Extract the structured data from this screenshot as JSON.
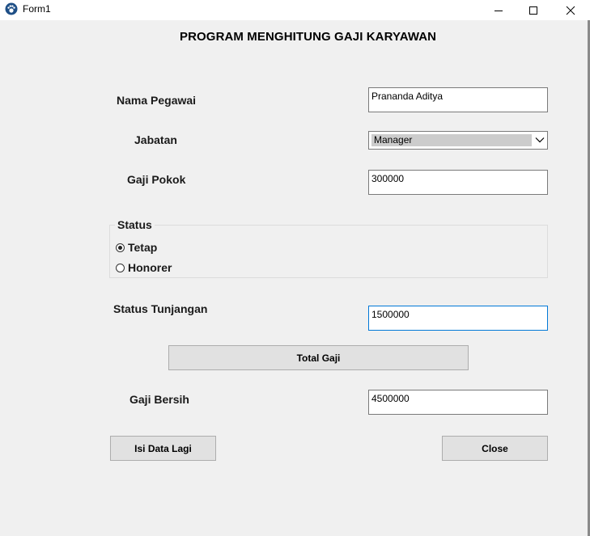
{
  "window": {
    "title": "Form1",
    "controls": [
      "minimize-icon",
      "maximize-icon",
      "close-icon"
    ]
  },
  "heading": "PROGRAM MENGHITUNG GAJI KARYAWAN",
  "form": {
    "nama_label": "Nama Pegawai",
    "nama_value": "Prananda Aditya",
    "jabatan_label": "Jabatan",
    "jabatan_value": "Manager",
    "gaji_pokok_label": "Gaji Pokok",
    "gaji_pokok_value": "300000",
    "status_group_title": "Status",
    "status_options": [
      {
        "label": "Tetap",
        "checked": true
      },
      {
        "label": "Honorer",
        "checked": false
      }
    ],
    "tunjangan_label": "Status Tunjangan",
    "tunjangan_value": "1500000",
    "total_gaji_button": "Total Gaji",
    "gaji_bersih_label": "Gaji Bersih",
    "gaji_bersih_value": "4500000",
    "isi_data_button": "Isi Data Lagi",
    "close_button": "Close"
  },
  "colors": {
    "client_bg": "#f0f0f0",
    "focus_border": "#0078d7",
    "button_bg": "#e1e1e1"
  }
}
